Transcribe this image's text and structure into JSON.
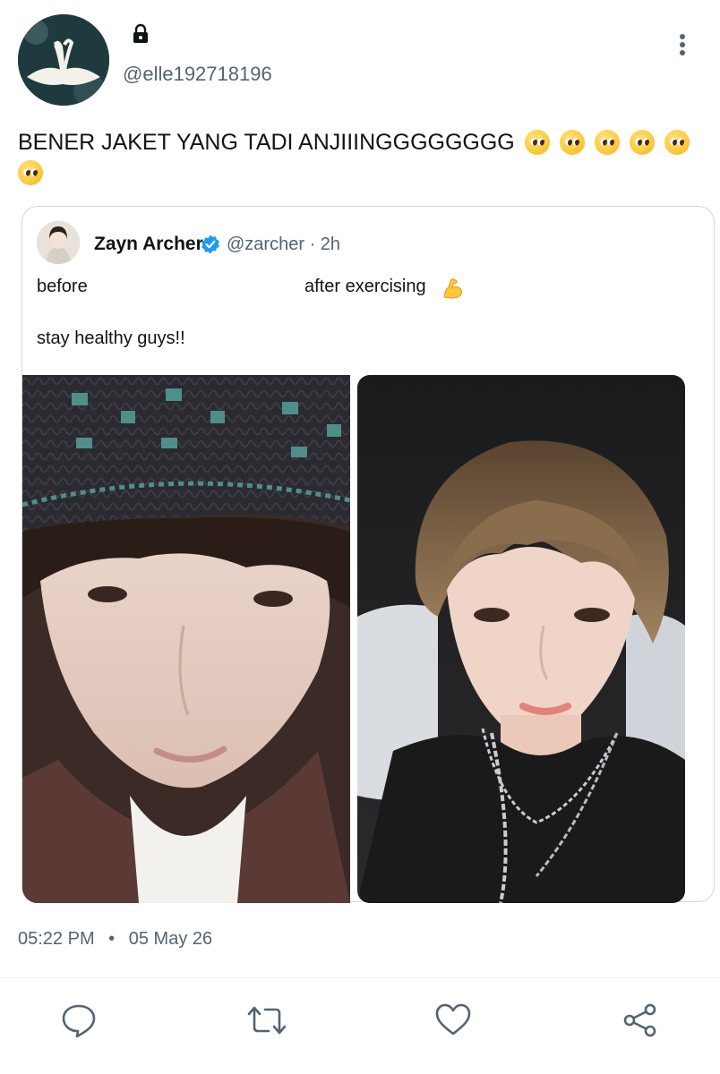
{
  "author": {
    "handle": "@elle192718196",
    "protected": true
  },
  "tweet": {
    "text": "BENER JAKET YANG TADI ANJIIINGGGGGGGG",
    "emoji_count": 6,
    "emoji": "pleading-face"
  },
  "quote": {
    "name": "Zayn Archer",
    "verified": true,
    "handle": "@zarcher",
    "separator": "·",
    "age": "2h",
    "line1_left": "before",
    "line1_right": "after exercising",
    "line1_emoji": "flexed-biceps",
    "line2": "stay healthy guys!!",
    "photos": [
      {
        "label": "before-photo"
      },
      {
        "label": "after-photo"
      }
    ]
  },
  "meta": {
    "time": "05:22 PM",
    "dot": "•",
    "date": "05 May 26"
  },
  "actions": [
    "reply-icon",
    "retweet-icon",
    "like-icon",
    "share-icon"
  ],
  "colors": {
    "text": "#0f1419",
    "secondary": "#536471",
    "verified": "#1d9bf0",
    "border": "#cfd9de"
  }
}
